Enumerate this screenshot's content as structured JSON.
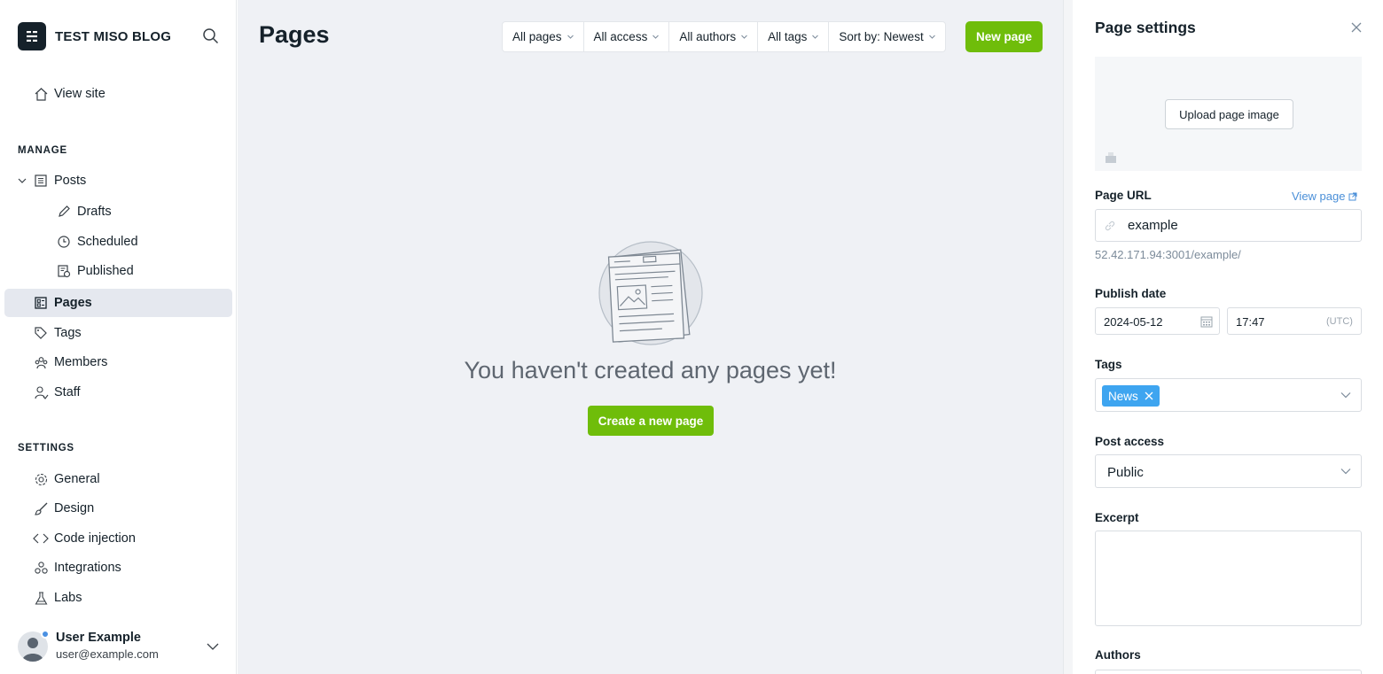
{
  "sidebar": {
    "brand": "TEST MISO BLOG",
    "view_site": "View site",
    "manage_label": "MANAGE",
    "posts": "Posts",
    "drafts": "Drafts",
    "scheduled": "Scheduled",
    "published": "Published",
    "pages": "Pages",
    "tags": "Tags",
    "members": "Members",
    "staff": "Staff",
    "settings_label": "SETTINGS",
    "general": "General",
    "design": "Design",
    "code_injection": "Code injection",
    "integrations": "Integrations",
    "labs": "Labs",
    "user_name": "User Example",
    "user_email": "user@example.com"
  },
  "main": {
    "title": "Pages",
    "filters": {
      "pages": "All pages",
      "access": "All access",
      "authors": "All authors",
      "tags": "All tags",
      "sort": "Sort by: Newest"
    },
    "new_page": "New page",
    "empty_text": "You haven't created any pages yet!",
    "create_button": "Create a new page"
  },
  "panel": {
    "title": "Page settings",
    "upload_image": "Upload page image",
    "page_url_label": "Page URL",
    "view_page": "View page",
    "url_value": "example",
    "url_hint": "52.42.171.94:3001/example/",
    "publish_date_label": "Publish date",
    "date_value": "2024-05-12",
    "time_value": "17:47",
    "timezone": "(UTC)",
    "tags_label": "Tags",
    "tag_chip": "News",
    "post_access_label": "Post access",
    "post_access_value": "Public",
    "excerpt_label": "Excerpt",
    "authors_label": "Authors"
  },
  "colors": {
    "accent_green": "#6fbd0a",
    "tag_blue": "#3ea5f0",
    "link_blue": "#4a8fd8"
  }
}
